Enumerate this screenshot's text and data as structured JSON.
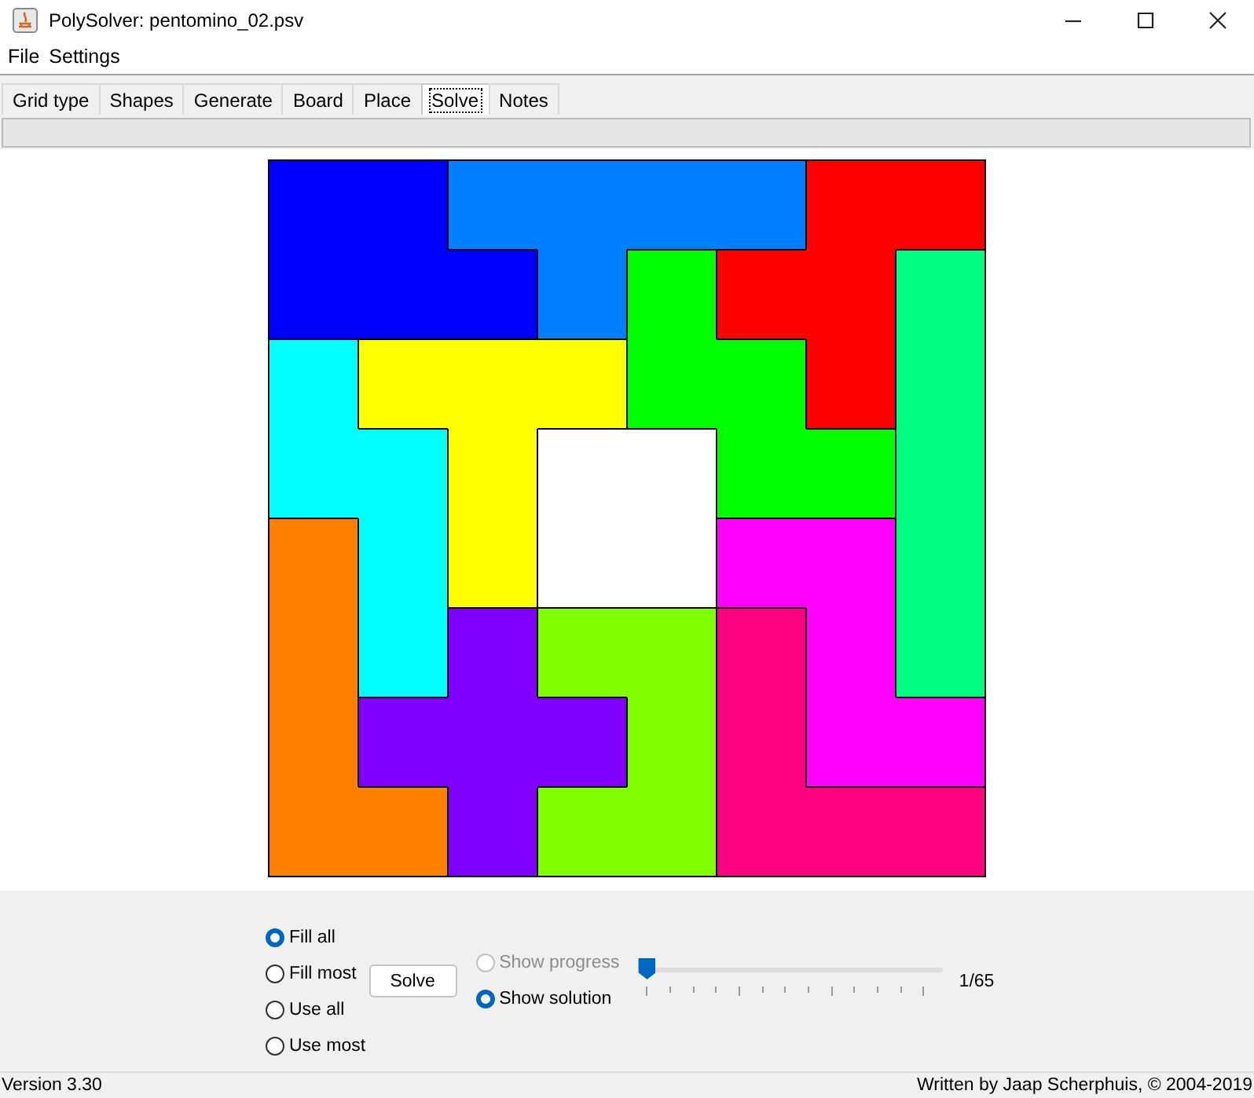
{
  "window": {
    "title": "PolySolver: pentomino_02.psv"
  },
  "menu": [
    "File",
    "Settings"
  ],
  "tabs": [
    {
      "label": "Grid type",
      "selected": false
    },
    {
      "label": "Shapes",
      "selected": false
    },
    {
      "label": "Generate",
      "selected": false
    },
    {
      "label": "Board",
      "selected": false
    },
    {
      "label": "Place",
      "selected": false
    },
    {
      "label": "Solve",
      "selected": true
    },
    {
      "label": "Notes",
      "selected": false
    }
  ],
  "progress_bar": {
    "level": 0
  },
  "board": {
    "rows": [
      [
        {
          "color": "#0000ff"
        },
        {
          "color": "#0000ff"
        },
        {
          "color": "#0080ff"
        },
        {
          "color": "#0080ff"
        },
        {
          "color": "#0080ff"
        },
        {
          "color": "#0080ff"
        },
        {
          "color": "#ff0000"
        },
        {
          "color": "#ff0000"
        }
      ],
      [
        {
          "color": "#0000ff"
        },
        {
          "color": "#0000ff"
        },
        {
          "color": "#0000ff"
        },
        {
          "color": "#0080ff"
        },
        {
          "color": "#00ff00"
        },
        {
          "color": "#ff0000"
        },
        {
          "color": "#ff0000"
        },
        {
          "color": "#00ff80"
        }
      ],
      [
        {
          "color": "#00ffff"
        },
        {
          "color": "#ffff00"
        },
        {
          "color": "#ffff00"
        },
        {
          "color": "#ffff00"
        },
        {
          "color": "#00ff00"
        },
        {
          "color": "#00ff00"
        },
        {
          "color": "#ff0000"
        },
        {
          "color": "#00ff80"
        }
      ],
      [
        {
          "color": "#00ffff"
        },
        {
          "color": "#00ffff"
        },
        {
          "color": "#ffff00"
        },
        {
          "kind": "empty"
        },
        {
          "kind": "empty"
        },
        {
          "color": "#00ff00"
        },
        {
          "color": "#00ff00"
        },
        {
          "color": "#00ff80"
        }
      ],
      [
        {
          "color": "#ff8000"
        },
        {
          "color": "#00ffff"
        },
        {
          "color": "#ffff00"
        },
        {
          "kind": "empty"
        },
        {
          "kind": "empty"
        },
        {
          "color": "#ff00ff"
        },
        {
          "color": "#ff00ff"
        },
        {
          "color": "#00ff80"
        }
      ],
      [
        {
          "color": "#ff8000"
        },
        {
          "color": "#00ffff"
        },
        {
          "color": "#8000ff"
        },
        {
          "color": "#80ff00"
        },
        {
          "color": "#80ff00"
        },
        {
          "color": "#ff0080"
        },
        {
          "color": "#ff00ff"
        },
        {
          "color": "#00ff80"
        }
      ],
      [
        {
          "color": "#ff8000"
        },
        {
          "color": "#8000ff"
        },
        {
          "color": "#8000ff"
        },
        {
          "color": "#8000ff"
        },
        {
          "color": "#80ff00"
        },
        {
          "color": "#ff0080"
        },
        {
          "color": "#ff00ff"
        },
        {
          "color": "#ff00ff"
        }
      ],
      [
        {
          "color": "#ff8000"
        },
        {
          "color": "#ff8000"
        },
        {
          "color": "#8000ff"
        },
        {
          "color": "#80ff00"
        },
        {
          "color": "#80ff00"
        },
        {
          "color": "#ff0080"
        },
        {
          "color": "#ff0080"
        },
        {
          "color": "#ff0080"
        }
      ]
    ]
  },
  "fill_modes": [
    {
      "label": "Fill all",
      "selected": true
    },
    {
      "label": "Fill most",
      "selected": false
    },
    {
      "label": "Use all",
      "selected": false
    },
    {
      "label": "Use most",
      "selected": false
    }
  ],
  "solve_button": "Solve",
  "display_options": [
    {
      "label": "Show progress",
      "selected": false,
      "disabled": true
    },
    {
      "label": "Show solution",
      "selected": true,
      "disabled": false
    }
  ],
  "solution_slider": {
    "level": 0,
    "reading": "1/65"
  },
  "status_bar": {
    "left": "Version 3.30",
    "right": "Written by Jaap Scherphuis, © 2004-2019"
  }
}
